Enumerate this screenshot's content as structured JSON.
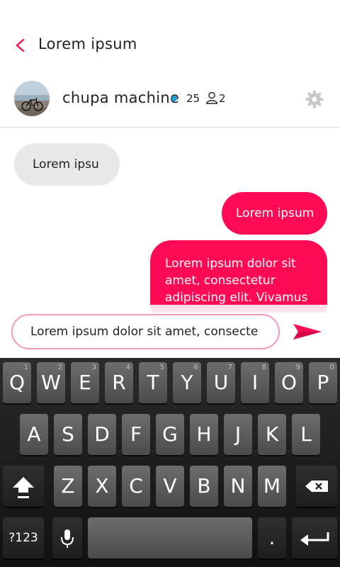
{
  "header": {
    "title": "Lorem ipsum"
  },
  "channel": {
    "name": "chupa machine",
    "message_count": "25",
    "member_count": "2"
  },
  "messages": [
    {
      "direction": "incoming",
      "text": "Lorem ipsu"
    },
    {
      "direction": "outgoing",
      "text": "Lorem ipsum"
    },
    {
      "direction": "outgoing",
      "text": "Lorem ipsum dolor sit amet, consectetur adipiscing elit. Vivamus"
    }
  ],
  "composer": {
    "value": "Lorem ipsum dolor sit amet, consecte"
  },
  "keyboard": {
    "row1": [
      {
        "label": "Q",
        "hint": "1"
      },
      {
        "label": "W",
        "hint": "2"
      },
      {
        "label": "E",
        "hint": "3"
      },
      {
        "label": "R",
        "hint": "4"
      },
      {
        "label": "T",
        "hint": "5"
      },
      {
        "label": "Y",
        "hint": "6"
      },
      {
        "label": "U",
        "hint": "7"
      },
      {
        "label": "I",
        "hint": "8"
      },
      {
        "label": "O",
        "hint": "9"
      },
      {
        "label": "P",
        "hint": "0"
      }
    ],
    "row2": [
      "A",
      "S",
      "D",
      "F",
      "G",
      "H",
      "J",
      "K",
      "L"
    ],
    "row3": [
      "Z",
      "X",
      "C",
      "V",
      "B",
      "N",
      "M"
    ],
    "symbols_label": "?123",
    "period_label": "."
  },
  "colors": {
    "accent": "#ff0a54",
    "accent_light": "#f49ab4",
    "incoming_bubble": "#e8e8e8",
    "online_dot": "#1ea0d8",
    "gear": "#c8c8c8"
  },
  "icons": {
    "back": "chevron-left-icon",
    "online": "online-dot-icon",
    "members": "person-icon",
    "settings": "gear-icon",
    "send": "send-icon",
    "shift": "shift-icon",
    "backspace": "backspace-icon",
    "microphone": "microphone-icon",
    "enter": "enter-icon"
  }
}
